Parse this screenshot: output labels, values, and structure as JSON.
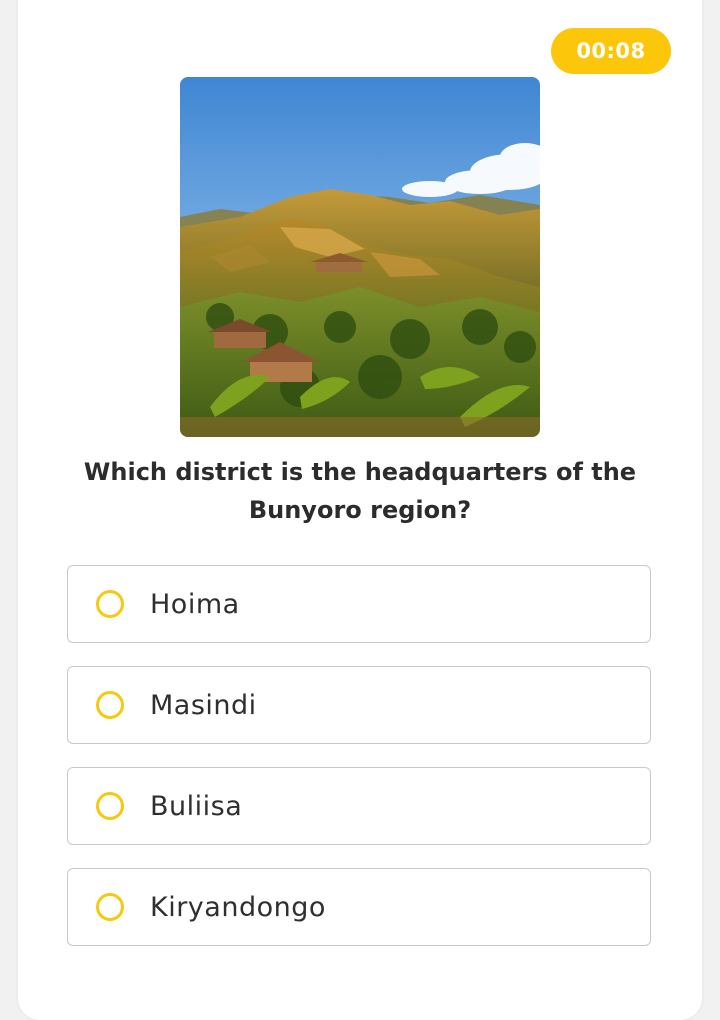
{
  "timer": {
    "value": "00:08"
  },
  "question": {
    "image_alt": "hillside-landscape",
    "text": "Which district is the headquarters of the Bunyoro region?"
  },
  "options": [
    {
      "label": "Hoima"
    },
    {
      "label": "Masindi"
    },
    {
      "label": "Buliisa"
    },
    {
      "label": "Kiryandongo"
    }
  ],
  "colors": {
    "accent": "#fcc70b",
    "radio_border": "#f6c90e",
    "text": "#2c2c2c",
    "option_border": "#c9c9c9"
  }
}
